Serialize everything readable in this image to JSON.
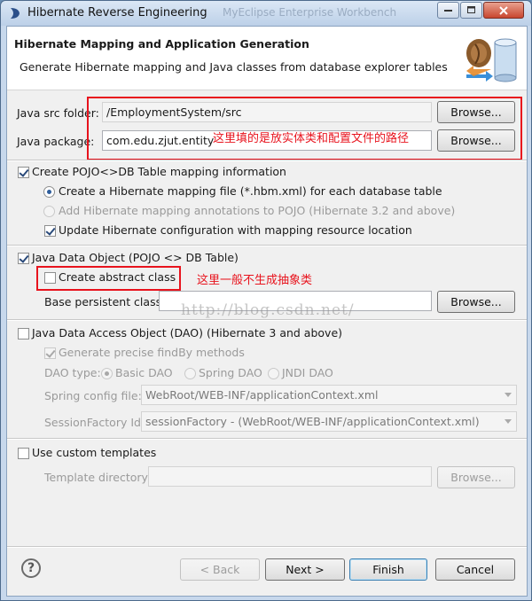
{
  "window": {
    "title": "Hibernate Reverse Engineering",
    "background_title": "MyEclipse Enterprise Workbench"
  },
  "header": {
    "title": "Hibernate Mapping and Application Generation",
    "subtitle": "Generate Hibernate mapping and Java classes from database explorer tables",
    "graphic": "database-mapping-icon"
  },
  "src_folder": {
    "label": "Java src folder:",
    "value": "/EmploymentSystem/src",
    "browse": "Browse..."
  },
  "package": {
    "label": "Java package:",
    "value": "com.edu.zjut.entity",
    "browse": "Browse..."
  },
  "annotation_paths": "这里填的是放实体类和配置文件的路径",
  "pojo_mapping": {
    "label": "Create POJO<>DB Table mapping information",
    "checked": true,
    "hbm_option": "Create a Hibernate mapping file (*.hbm.xml) for each database table",
    "annotations_option": "Add Hibernate mapping annotations to POJO (Hibernate 3.2 and above)",
    "update_config": "Update Hibernate configuration with mapping resource location"
  },
  "java_data_object": {
    "label": "Java Data Object (POJO <> DB Table)",
    "checked": true,
    "abstract_class": "Create abstract class",
    "annotation": "这里一般不生成抽象类",
    "base_persistent_label": "Base persistent class:",
    "base_persistent_value": "",
    "browse": "Browse..."
  },
  "dao": {
    "label": "Java Data Access Object (DAO) (Hibernate 3 and above)",
    "checked": false,
    "precise_findby": "Generate precise findBy methods",
    "type_label": "DAO type:",
    "types": [
      "Basic DAO",
      "Spring DAO",
      "JNDI DAO"
    ],
    "spring_config_label": "Spring config file:",
    "spring_config_value": "WebRoot/WEB-INF/applicationContext.xml",
    "session_factory_label": "SessionFactory Id:",
    "session_factory_value": "sessionFactory - (WebRoot/WEB-INF/applicationContext.xml)"
  },
  "templates": {
    "label": "Use custom templates",
    "checked": false,
    "directory_label": "Template directory:",
    "directory_value": "",
    "browse": "Browse..."
  },
  "watermark": "http://blog.csdn.net/",
  "footer": {
    "help": "?",
    "back": "< Back",
    "next": "Next >",
    "finish": "Finish",
    "cancel": "Cancel"
  },
  "colors": {
    "annotation_red": "#e8131d",
    "window_frame": "#c7d8ec",
    "dialog_bg": "#f0f0f0"
  }
}
